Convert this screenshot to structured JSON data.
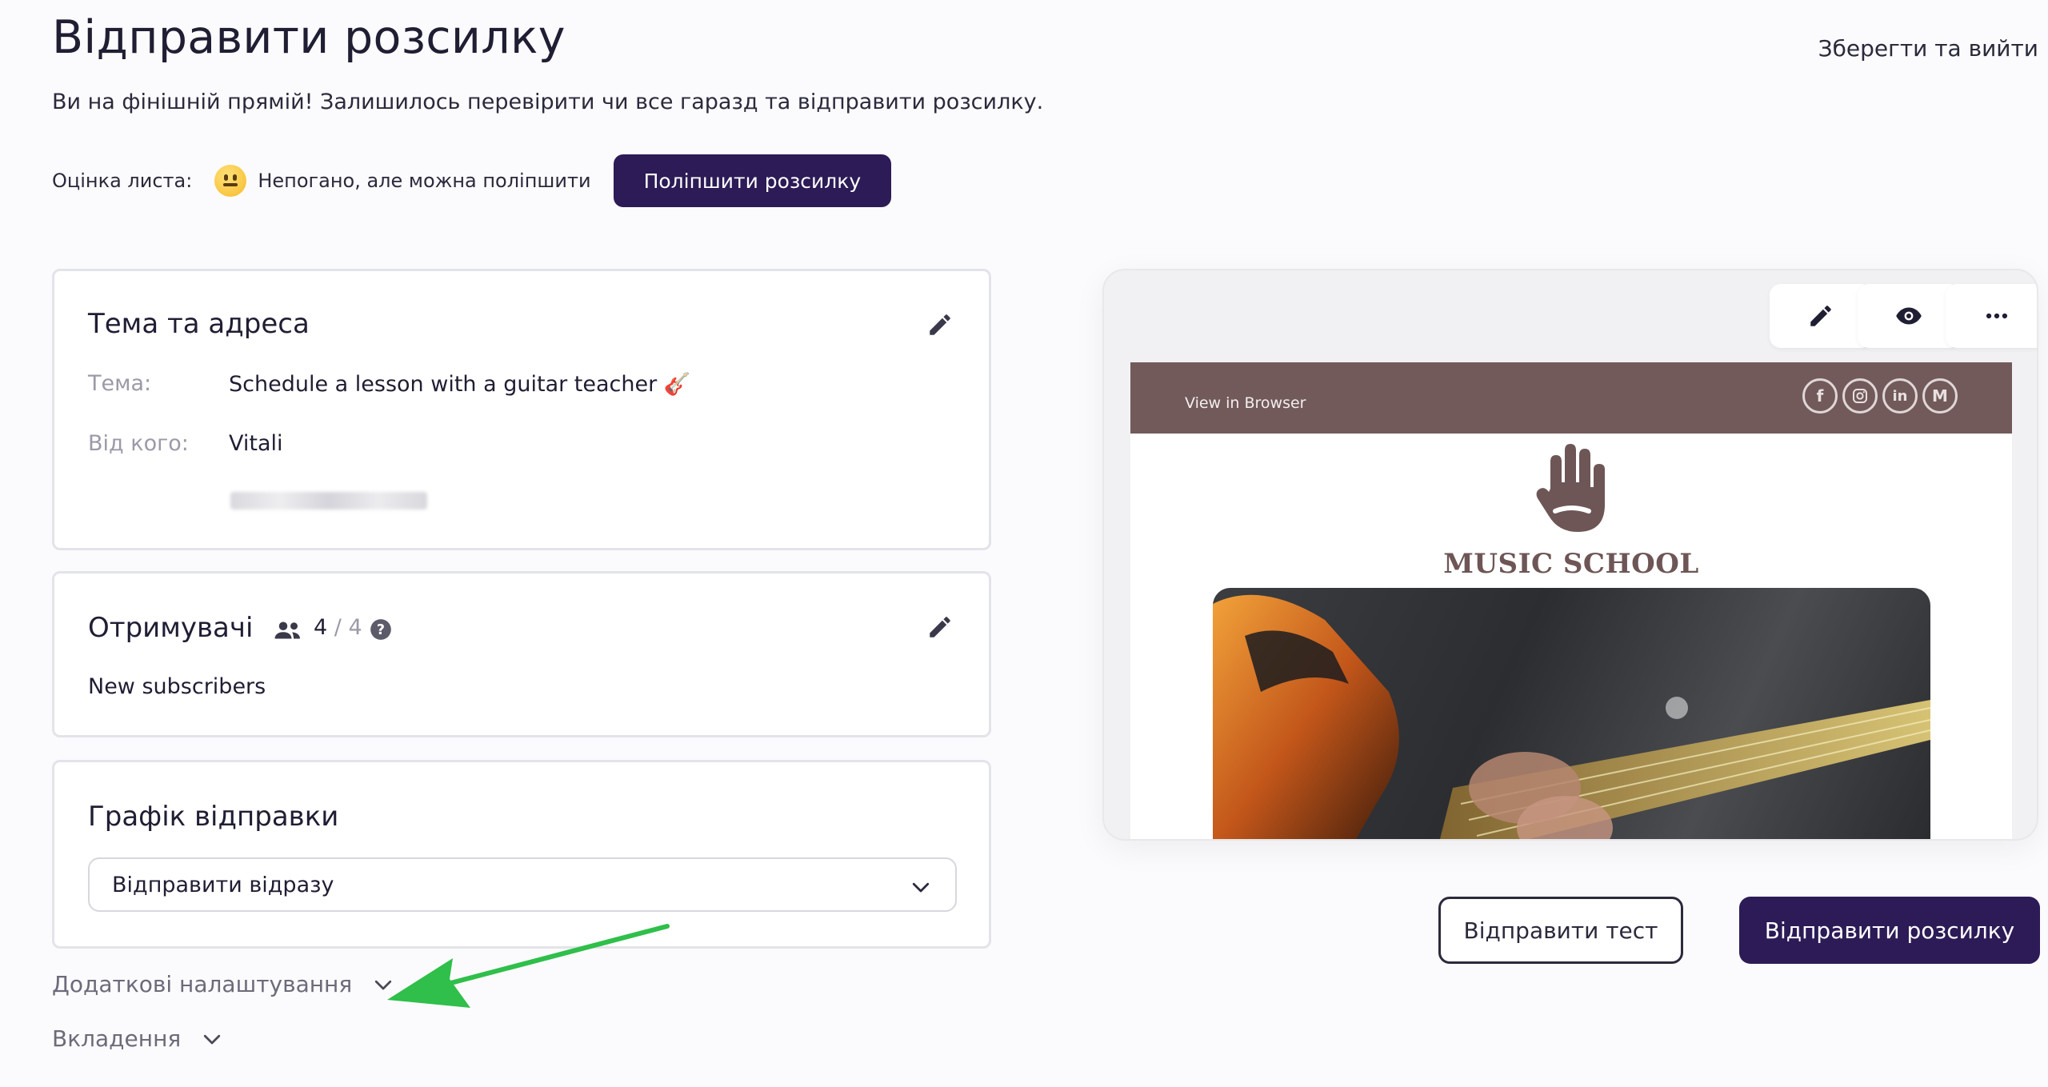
{
  "header": {
    "title": "Відправити розсилку",
    "save_exit": "Зберегти та вийти",
    "subtitle": "Ви на фінішній прямій! Залишилось перевірити чи все гаразд та відправити розсилку."
  },
  "rating": {
    "label": "Оцінка листа:",
    "text": "Непогано, але можна поліпшити",
    "improve_button": "Поліпшити розсилку"
  },
  "subject_card": {
    "title": "Тема та адреса",
    "subject_label": "Тема:",
    "subject_value": "Schedule a lesson with a guitar teacher 🎸",
    "from_label": "Від кого:",
    "from_value": "Vitali"
  },
  "recipients_card": {
    "title": "Отримувачі",
    "count": "4",
    "separator": "/",
    "total": "4",
    "list_name": "New subscribers"
  },
  "schedule_card": {
    "title": "Графік відправки",
    "selected": "Відправити відразу"
  },
  "extra": {
    "additional_settings": "Додаткові налаштування",
    "attachments": "Вкладення"
  },
  "preview": {
    "view_in_browser": "View in Browser",
    "brand": "MUSIC SCHOOL",
    "social_icons": [
      "facebook-icon",
      "instagram-icon",
      "linkedin-icon",
      "medium-icon"
    ]
  },
  "actions": {
    "send_test": "Відправити тест",
    "send_campaign": "Відправити розсилку"
  },
  "colors": {
    "primary": "#2c1b56",
    "email_header": "#725a5a",
    "annotation_arrow": "#2fbf4a"
  }
}
